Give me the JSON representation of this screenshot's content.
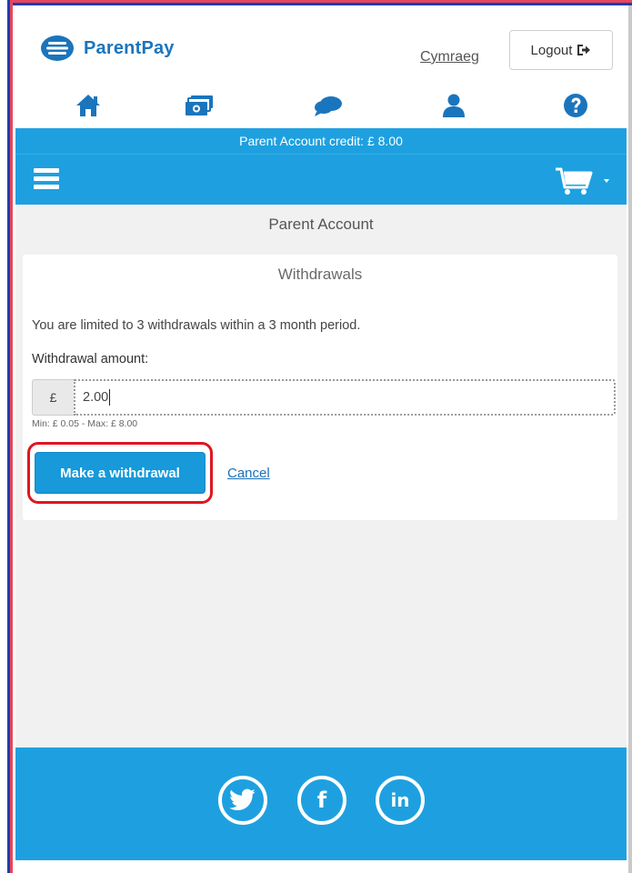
{
  "header": {
    "brand_name": "ParentPay",
    "language_link": "Cymraeg",
    "logout_label": "Logout",
    "nav_icons": [
      "home-icon",
      "payments-icon",
      "messages-icon",
      "profile-icon",
      "help-icon"
    ]
  },
  "credit_bar": {
    "text": "Parent Account credit: £ 8.00"
  },
  "page": {
    "section_title": "Parent Account",
    "card_title": "Withdrawals",
    "limit_text": "You are limited to 3 withdrawals within a 3 month period.",
    "amount_label": "Withdrawal amount:",
    "currency_symbol": "£",
    "amount_value": "2.00",
    "range_hint": "Min: £ 0.05 - Max: £ 8.00",
    "withdraw_button": "Make a withdrawal",
    "cancel_link": "Cancel"
  },
  "footer": {
    "social_icons": [
      "twitter-icon",
      "facebook-icon",
      "linkedin-icon"
    ],
    "linkedin_text": "in",
    "facebook_text": "f"
  },
  "colors": {
    "brand_blue": "#1ea0e0",
    "button_blue": "#1799da",
    "highlight_red": "#e0161e"
  }
}
